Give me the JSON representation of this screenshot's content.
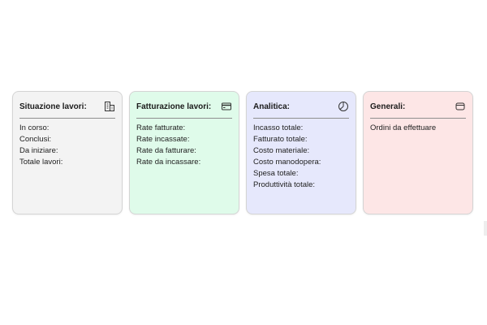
{
  "cards": [
    {
      "title": "Situazione lavori:",
      "icon": "buildings-icon",
      "bg": "#f3f3f3",
      "items": [
        "In corso:",
        "Conclusi:",
        "Da iniziare:",
        "Totale lavori:"
      ]
    },
    {
      "title": "Fatturazione lavori:",
      "icon": "credit-card-icon",
      "bg": "#dffbea",
      "items": [
        "Rate fatturate:",
        "Rate incassate:",
        "Rate da fatturare:",
        "Rate da incassare:"
      ]
    },
    {
      "title": "Analitica:",
      "icon": "pie-chart-icon",
      "bg": "#e6e8fc",
      "items": [
        "Incasso totale:",
        "Fatturato totale:",
        "Costo materiale:",
        "Costo manodopera:",
        "Spesa totale:",
        "Produttività totale:"
      ]
    },
    {
      "title": "Generali:",
      "icon": "archive-icon",
      "bg": "#fde6e6",
      "items": [
        "Ordini da effettuare"
      ]
    }
  ]
}
